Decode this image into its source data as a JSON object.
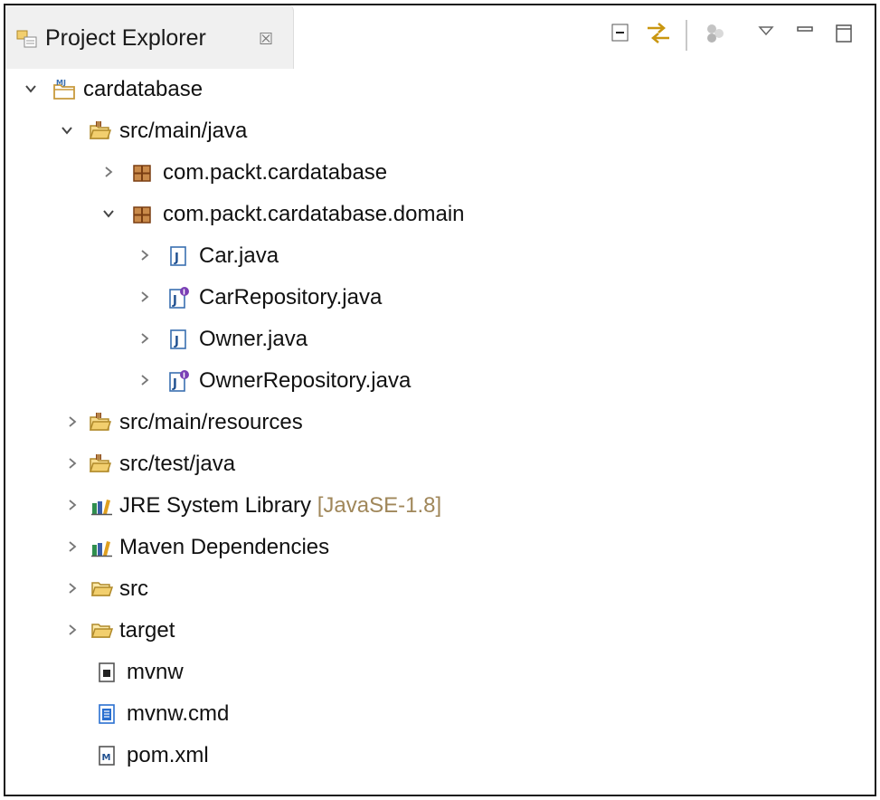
{
  "view": {
    "title": "Project Explorer",
    "close_glyph": "☒"
  },
  "toolbar": {
    "items": [
      {
        "name": "collapse-all-icon"
      },
      {
        "name": "link-with-editor-icon"
      },
      {
        "name": "focus-on-active-task-icon"
      },
      {
        "name": "view-menu-icon"
      },
      {
        "name": "minimize-icon"
      },
      {
        "name": "maximize-icon"
      }
    ]
  },
  "tree": {
    "project": {
      "label": "cardatabase",
      "expanded": true
    },
    "src_main_java": {
      "label": "src/main/java",
      "expanded": true
    },
    "pkg_cardatabase": {
      "label": "com.packt.cardatabase",
      "expanded": false
    },
    "pkg_domain": {
      "label": "com.packt.cardatabase.domain",
      "expanded": true
    },
    "car_java": {
      "label": "Car.java"
    },
    "car_repository_java": {
      "label": "CarRepository.java"
    },
    "owner_java": {
      "label": "Owner.java"
    },
    "owner_repository_java": {
      "label": "OwnerRepository.java"
    },
    "src_main_resources": {
      "label": "src/main/resources"
    },
    "src_test_java": {
      "label": "src/test/java"
    },
    "jre_library": {
      "label": "JRE System Library",
      "decoration": "[JavaSE-1.8]"
    },
    "maven_dependencies": {
      "label": "Maven Dependencies"
    },
    "src_folder": {
      "label": "src"
    },
    "target_folder": {
      "label": "target"
    },
    "mvnw": {
      "label": "mvnw"
    },
    "mvnw_cmd": {
      "label": "mvnw.cmd"
    },
    "pom_xml": {
      "label": "pom.xml"
    }
  },
  "colors": {
    "decoration": "#a0875a",
    "source_folder": "#c89a3c",
    "package": "#8b4a1c",
    "java_file": "#3a6fb0",
    "interface_badge": "#7a3fb5"
  }
}
